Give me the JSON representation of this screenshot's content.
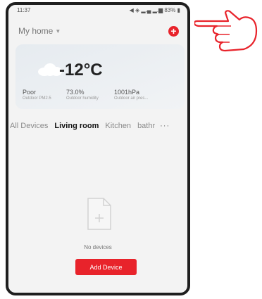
{
  "status_bar": {
    "time": "11:37",
    "indicators": "◀ ◈ ▂.▄ ▂.▆ 83% ▮"
  },
  "header": {
    "home_name": "My home",
    "chevron_icon": "chevron-down-icon",
    "add_icon": "plus-circle-icon"
  },
  "weather": {
    "temperature": "-12°C",
    "icon": "cloud-icon",
    "metrics": [
      {
        "value": "Poor",
        "label": "Outdoor PM2.5"
      },
      {
        "value": "73.0%",
        "label": "Outdoor humidity"
      },
      {
        "value": "1001hPa",
        "label": "Outdoor air pres..."
      }
    ]
  },
  "tabs": [
    {
      "label": "All Devices"
    },
    {
      "label": "Living room"
    },
    {
      "label": "Kitchen"
    },
    {
      "label": "bathr"
    }
  ],
  "more_label": "···",
  "active_tab_index": 1,
  "empty_state": {
    "icon": "empty-file-icon",
    "text": "No devices",
    "button": "Add Device"
  },
  "colors": {
    "accent": "#e8232b",
    "text": "#222222",
    "muted": "#8a8a8a",
    "background": "#f3f3f3"
  }
}
